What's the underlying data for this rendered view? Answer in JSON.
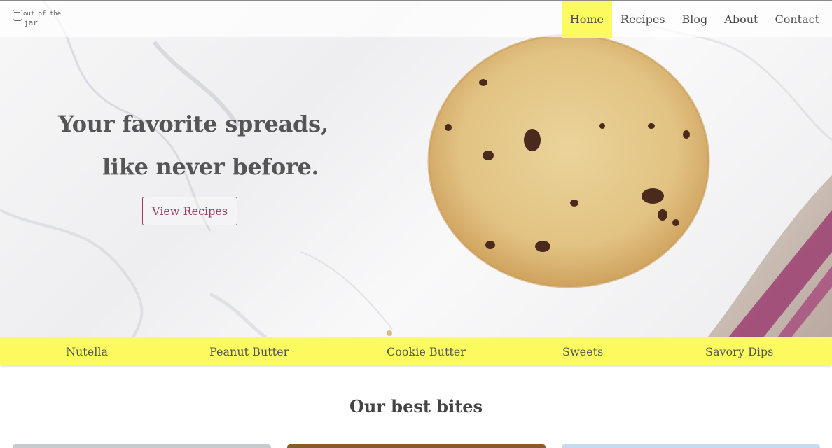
{
  "logo": {
    "line1": "out of the",
    "line2": "jar"
  },
  "nav": {
    "items": [
      {
        "label": "Home",
        "active": true
      },
      {
        "label": "Recipes"
      },
      {
        "label": "Blog"
      },
      {
        "label": "About"
      },
      {
        "label": "Contact"
      }
    ]
  },
  "hero": {
    "headline_line1": "Your favorite spreads,",
    "headline_line2": "like never before.",
    "cta_label": "View Recipes"
  },
  "categories": {
    "items": [
      "Nutella",
      "Peanut Butter",
      "Cookie Butter",
      "Sweets",
      "Savory Dips"
    ]
  },
  "section": {
    "title": "Our best bites"
  },
  "colors": {
    "accent_yellow": "#fbfa5e",
    "button_plum": "#9a3b62",
    "text_gray": "#4a4a4a"
  }
}
